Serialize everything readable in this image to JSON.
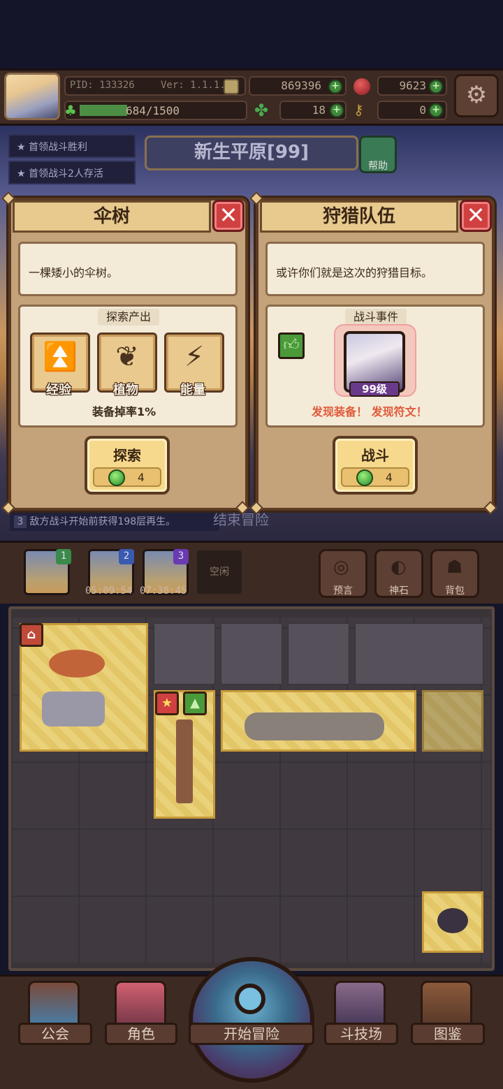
{
  "header": {
    "pid": "PID: 133326",
    "version": "Ver: 1.1.1.3",
    "gold": "869396",
    "gems": "9623",
    "energy": "684/1500",
    "energy_fraction": 0.456,
    "clovers": "18",
    "keys": "0"
  },
  "quests": [
    "首领战斗胜利",
    "首领战斗2人存活"
  ],
  "location": {
    "name": "新生平原[99]",
    "help_label": "帮助"
  },
  "left_panel": {
    "title": "伞树",
    "description": "一棵矮小的伞树。",
    "section_title": "探索产出",
    "resources": [
      {
        "label": "经验",
        "icon": "double-chevron-up-icon"
      },
      {
        "label": "植物",
        "icon": "leaf-icon"
      },
      {
        "label": "能量",
        "icon": "lightning-icon"
      }
    ],
    "drop_rate": "装备掉率1%",
    "action_label": "探索",
    "cost": "4"
  },
  "right_panel": {
    "title": "狩猎队伍",
    "description": "或许你们就是这次的狩猎目标。",
    "section_title": "战斗事件",
    "enemy_level": "99级",
    "discovery": "发现装备！ 发现符文！",
    "action_label": "战斗",
    "cost": "4"
  },
  "bg_text": {
    "regen_note": "敌方战斗开始前获得198层再生。",
    "regen_index": "3",
    "faded_label": "结束冒险"
  },
  "slots": [
    {
      "num": "1",
      "time": ""
    },
    {
      "num": "2",
      "time": "05:09:54"
    },
    {
      "num": "3",
      "time": "07:38:45"
    }
  ],
  "idle_label": "空闲",
  "side_buttons": [
    {
      "label": "预言",
      "icon": "crystal-ball-icon"
    },
    {
      "label": "神石",
      "icon": "rune-stone-icon"
    },
    {
      "label": "背包",
      "icon": "backpack-icon"
    }
  ],
  "nav": {
    "guild": "公会",
    "character": "角色",
    "start": "开始冒险",
    "arena": "斗技场",
    "codex": "图鉴"
  },
  "colors": {
    "panel_bg": "#c4a27a",
    "close_red": "#d04040",
    "discovery_red": "#e05a3a",
    "tile_gold": "#ead27a"
  }
}
